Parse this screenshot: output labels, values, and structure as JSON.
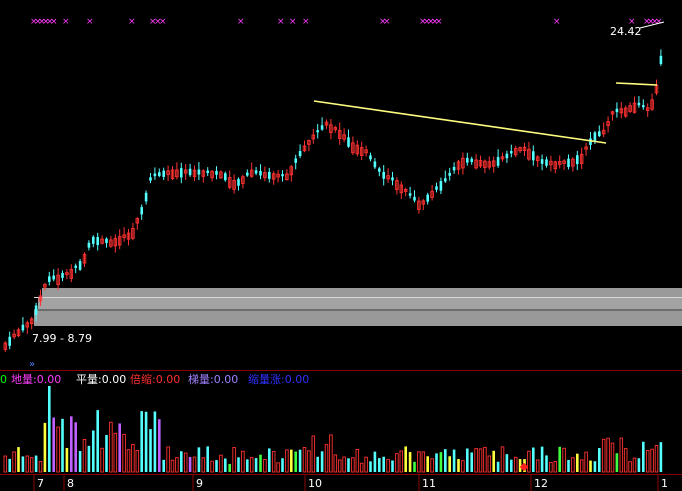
{
  "signal_glyph": "×",
  "price_panel": {
    "last_price_label": "24.42",
    "range_label": "7.99 - 8.79",
    "expand_glyph": "»"
  },
  "indicator_bar": {
    "lead": "0",
    "items": [
      {
        "label": "地量:",
        "value": "0.00",
        "color": "#ff3cff"
      },
      {
        "label": "平量:",
        "value": "0.00",
        "color": "#ffffff"
      },
      {
        "label": "倍缩:",
        "value": "0.00",
        "color": "#ff3030"
      },
      {
        "label": "梯量:",
        "value": "0.00",
        "color": "#a080ff"
      },
      {
        "label": "缩量涨:",
        "value": "0.00",
        "color": "#3030ff"
      }
    ]
  },
  "time_axis": [
    "7",
    "8",
    "9",
    "10",
    "11",
    "12",
    "1"
  ],
  "colors": {
    "up": "#ff3232",
    "down": "#54ffff",
    "grid": "#8b0000",
    "trendline": "#ffff80",
    "signal": "#ff3cff",
    "volume_band": "#a0a0a0"
  },
  "chart_data": {
    "type": "candlestick",
    "title": "",
    "series": [
      {
        "name": "price",
        "ohlc_count": 150
      },
      {
        "name": "volume",
        "bar_count": 150
      }
    ],
    "last_price": 24.42,
    "volume_profile_range": [
      7.99,
      8.79
    ]
  }
}
